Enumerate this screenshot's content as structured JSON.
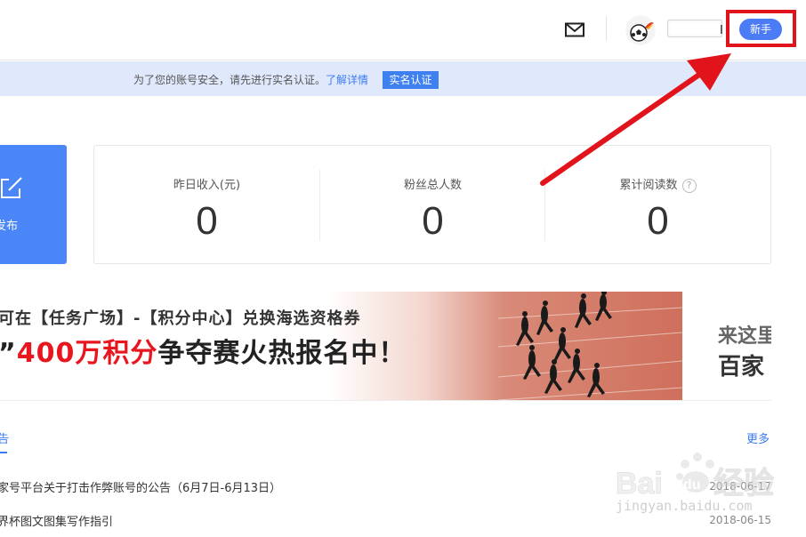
{
  "header": {
    "mail_icon": "mail-icon",
    "avatar_icon": "avatar",
    "newbie_label": "新手",
    "highlight_color": "#e1141b"
  },
  "notice": {
    "text": "为了您的账号安全，请先进行实名认证。",
    "link": "了解详情",
    "button": "实名认证"
  },
  "publish": {
    "icon": "edit-icon",
    "label": "发布"
  },
  "stats": [
    {
      "label": "昨日收入(元)",
      "value": "0"
    },
    {
      "label": "粉丝总人数",
      "value": "0"
    },
    {
      "label": "累计阅读数",
      "value": "0",
      "help": "?"
    }
  ],
  "banner": {
    "line1": "可在【任务广场】-【积分中心】兑换海选资格券",
    "line2_prefix": "”",
    "line2_red": "400万积分",
    "line2_suffix": "争夺赛火热报名中！",
    "side_line1": "来这里",
    "side_line2": "百家"
  },
  "announcements": {
    "tab": "告",
    "more": "更多",
    "items": [
      {
        "title": "家号平台关于打击作弊账号的公告（6月7日-6月13日）",
        "date": "2018-06-17"
      },
      {
        "title": "界杯图文图集写作指引",
        "date": "2018-06-15"
      }
    ]
  },
  "watermark": {
    "text": "jingyan.baidu.com"
  }
}
